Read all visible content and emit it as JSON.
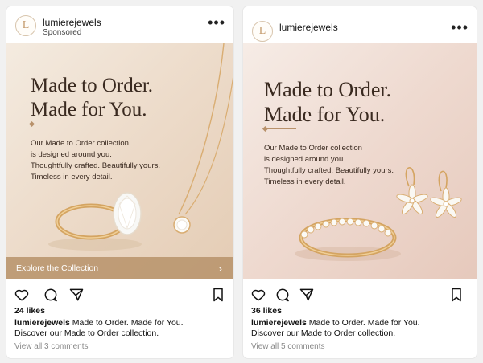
{
  "posts": [
    {
      "username": "lumierejewels",
      "sponsored": "Sponsored",
      "logo_letter": "L",
      "headline_line1": "Made to Order.",
      "headline_line2": "Made for You.",
      "body": [
        "Our Made to Order collection",
        "is designed around you.",
        "Thoughtfully crafted. Beautifully yours.",
        "Timeless in every detail."
      ],
      "cta_label": "Explore the Collection",
      "likes": "24 likes",
      "caption_user": "lumierejewels",
      "caption_line1": "Made to Order. Made for You.",
      "caption_line2": "Discover our Made to Order collection.",
      "comments": "View all 3 comments",
      "image_subject": "oval diamond ring and solitaire necklace"
    },
    {
      "username": "lumierejewels",
      "logo_letter": "L",
      "headline_line1": "Made to Order.",
      "headline_line2": "Made for You.",
      "body": [
        "Our Made to Order collection",
        "is designed around you.",
        "Thoughtfully crafted. Beautifully yours.",
        "Timeless in every detail."
      ],
      "likes": "36 likes",
      "caption_user": "lumierejewels",
      "caption_line1": "Made to Order. Made for You.",
      "caption_line2": "Discover our Made to Order collection.",
      "comments": "View all 5 comments",
      "image_subject": "diamond band ring and flower drop earrings"
    }
  ],
  "icons": [
    "more-icon",
    "heart-icon",
    "comment-icon",
    "share-icon",
    "bookmark-icon",
    "chevron-right-icon"
  ],
  "colors": {
    "accent": "#b8916a",
    "cta_bg": "#b8946c",
    "gold": "#d4a86a",
    "text_dark": "#3a2a20"
  }
}
